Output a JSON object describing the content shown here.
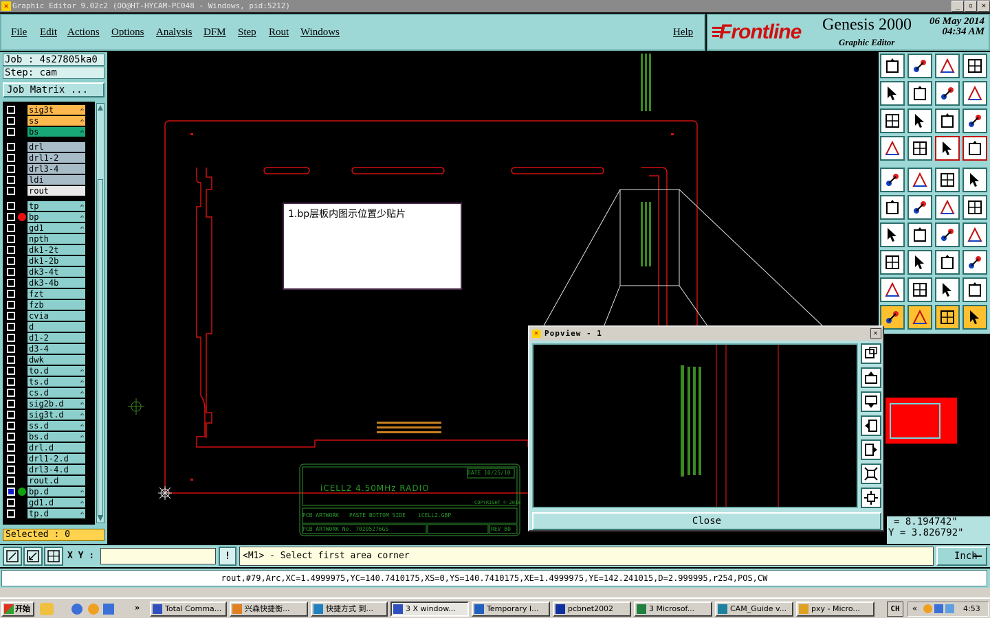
{
  "window": {
    "title": "Graphic Editor 9.02c2  (OO@HT-HYCAM-PC048 - Windows, pid:5212)"
  },
  "menu": {
    "items": [
      "File",
      "Edit",
      "Actions",
      "Options",
      "Analysis",
      "DFM",
      "Step",
      "Rout",
      "Windows"
    ],
    "help": "Help"
  },
  "brand": {
    "logo": "Frontline",
    "product": "Genesis 2000",
    "subtitle": "Graphic Editor",
    "date": "06 May 2014",
    "time": "04:34 AM"
  },
  "job": {
    "job_label": "Job : 4s27805ka0",
    "step_label": "Step: cam",
    "matrix_button": "Job Matrix ..."
  },
  "layers": [
    {
      "name": "sig3t",
      "color": "#ffb84d",
      "fx": true
    },
    {
      "name": "ss",
      "color": "#ffb84d",
      "fx": true
    },
    {
      "name": "bs",
      "color": "#18a878",
      "fx": true
    },
    {
      "name": "drl",
      "color": "#a8bcc8",
      "fx": false
    },
    {
      "name": "drl1-2",
      "color": "#a8bcc8",
      "fx": false
    },
    {
      "name": "drl3-4",
      "color": "#a8bcc8",
      "fx": false
    },
    {
      "name": "ldi",
      "color": "#a8bcc8",
      "fx": false
    },
    {
      "name": "rout",
      "color": "#e8e8e8",
      "fx": false
    },
    {
      "name": "tp",
      "color": "#8ccfcc",
      "fx": true
    },
    {
      "name": "bp",
      "color": "#8ccfcc",
      "fx": true,
      "dot": "#e81010"
    },
    {
      "name": "gd1",
      "color": "#8ccfcc",
      "fx": true
    },
    {
      "name": "npth",
      "color": "#8ccfcc",
      "fx": false
    },
    {
      "name": "dk1-2t",
      "color": "#8ccfcc",
      "fx": false
    },
    {
      "name": "dk1-2b",
      "color": "#8ccfcc",
      "fx": false
    },
    {
      "name": "dk3-4t",
      "color": "#8ccfcc",
      "fx": false
    },
    {
      "name": "dk3-4b",
      "color": "#8ccfcc",
      "fx": false
    },
    {
      "name": "fzt",
      "color": "#8ccfcc",
      "fx": false
    },
    {
      "name": "fzb",
      "color": "#8ccfcc",
      "fx": false
    },
    {
      "name": "cvia",
      "color": "#8ccfcc",
      "fx": false
    },
    {
      "name": "d",
      "color": "#8ccfcc",
      "fx": false
    },
    {
      "name": "d1-2",
      "color": "#8ccfcc",
      "fx": false
    },
    {
      "name": "d3-4",
      "color": "#8ccfcc",
      "fx": false
    },
    {
      "name": "dwk",
      "color": "#8ccfcc",
      "fx": false
    },
    {
      "name": "to.d",
      "color": "#8ccfcc",
      "fx": true
    },
    {
      "name": "ts.d",
      "color": "#8ccfcc",
      "fx": true
    },
    {
      "name": "cs.d",
      "color": "#8ccfcc",
      "fx": true
    },
    {
      "name": "sig2b.d",
      "color": "#8ccfcc",
      "fx": true
    },
    {
      "name": "sig3t.d",
      "color": "#8ccfcc",
      "fx": true
    },
    {
      "name": "ss.d",
      "color": "#8ccfcc",
      "fx": true
    },
    {
      "name": "bs.d",
      "color": "#8ccfcc",
      "fx": true
    },
    {
      "name": "drl.d",
      "color": "#8ccfcc",
      "fx": false
    },
    {
      "name": "drl1-2.d",
      "color": "#8ccfcc",
      "fx": false
    },
    {
      "name": "drl3-4.d",
      "color": "#8ccfcc",
      "fx": false
    },
    {
      "name": "rout.d",
      "color": "#8ccfcc",
      "fx": false
    },
    {
      "name": "bp.d",
      "color": "#8ccfcc",
      "fx": true,
      "dot": "#10a010",
      "work": true
    },
    {
      "name": "gd1.d",
      "color": "#8ccfcc",
      "fx": true
    },
    {
      "name": "tp.d",
      "color": "#8ccfcc",
      "fx": true
    }
  ],
  "selected": "Selected : 0",
  "annotation_note": "1.bp层板内图示位置少贴片",
  "title_block": {
    "date": "DATE 10/25/10",
    "board": "iCELL2  4.50MHz  RADIO",
    "copyright": "COPYRIGHT © 2010",
    "pcb_artwork": "PCB ARTWORK",
    "paste_side": "PASTE BOTTOM SIDE",
    "file": "iCELL2.GBP",
    "artwork_no": "PCB ARTWORK No. 70205276GS",
    "rev": "REV B0"
  },
  "popview": {
    "title": "Popview - 1",
    "close": "Close"
  },
  "coords": {
    "x": "= 8.194742\"",
    "y": "Y = 3.826792\""
  },
  "command": {
    "xy_label": "X Y :",
    "xy_value": "",
    "prompt": "<M1> - Select first area corner",
    "units": "Inch"
  },
  "status": "rout,#79,Arc,XC=1.4999975,YC=140.7410175,XS=0,YS=140.7410175,XE=1.4999975,YE=142.241015,D=2.999995,r254,POS,CW",
  "taskbar": {
    "start": "开始",
    "clock": "4:53",
    "lang": "CH",
    "tasks": [
      {
        "label": "Total Comma...",
        "active": false
      },
      {
        "label": "兴森快捷衡...",
        "active": false
      },
      {
        "label": "快捷方式 到...",
        "active": false
      },
      {
        "label": "3 X window...",
        "active": true
      },
      {
        "label": "Temporary I...",
        "active": false
      },
      {
        "label": "pcbnet2002",
        "active": false
      },
      {
        "label": "3 Microsof...",
        "active": false
      },
      {
        "label": "CAM_Guide v...",
        "active": false
      },
      {
        "label": "pxy - Micro...",
        "active": false
      }
    ]
  }
}
